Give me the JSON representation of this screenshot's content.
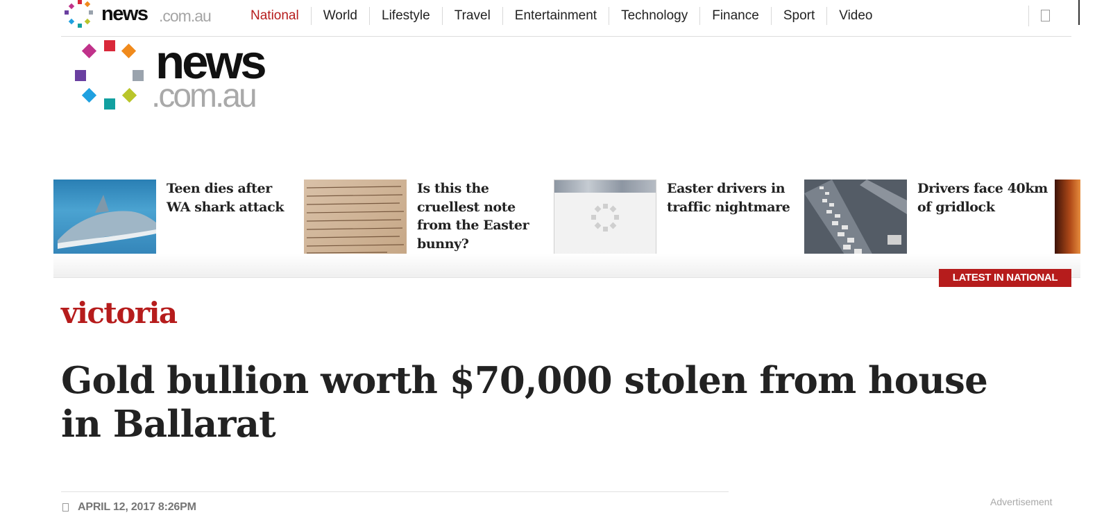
{
  "header": {
    "logo": {
      "news": "news",
      "domain": ".com.au"
    },
    "nav": [
      {
        "label": "National",
        "active": true
      },
      {
        "label": "World",
        "active": false
      },
      {
        "label": "Lifestyle",
        "active": false
      },
      {
        "label": "Travel",
        "active": false
      },
      {
        "label": "Entertainment",
        "active": false
      },
      {
        "label": "Technology",
        "active": false
      },
      {
        "label": "Finance",
        "active": false
      },
      {
        "label": "Sport",
        "active": false
      },
      {
        "label": "Video",
        "active": false
      }
    ],
    "search_icon": "search-icon"
  },
  "masthead": {
    "news": "news",
    "domain": ".com.au"
  },
  "strip": {
    "stories": [
      {
        "headline": "Teen dies after WA shark attack",
        "thumb": "shark"
      },
      {
        "headline": "Is this the cruellest note from the Easter bunny?",
        "thumb": "note"
      },
      {
        "headline": "Easter drivers in traffic nightmare",
        "thumb": "loading"
      },
      {
        "headline": "Drivers face 40km of gridlock",
        "thumb": "traffic"
      }
    ],
    "latest_label": "LATEST IN NATIONAL"
  },
  "article": {
    "section": "victoria",
    "title": "Gold bullion worth $70,000 stolen from house in Ballarat",
    "date": "APRIL 12, 2017 8:26PM",
    "advertisement_label": "Advertisement"
  },
  "colors": {
    "accent": "#b61c1c",
    "logo_dots": [
      "#c0328a",
      "#d9283a",
      "#f08a1c",
      "#9aa3ad",
      "#b9c52a",
      "#12a0a0",
      "#1fa0e0",
      "#6a3fa0"
    ]
  }
}
